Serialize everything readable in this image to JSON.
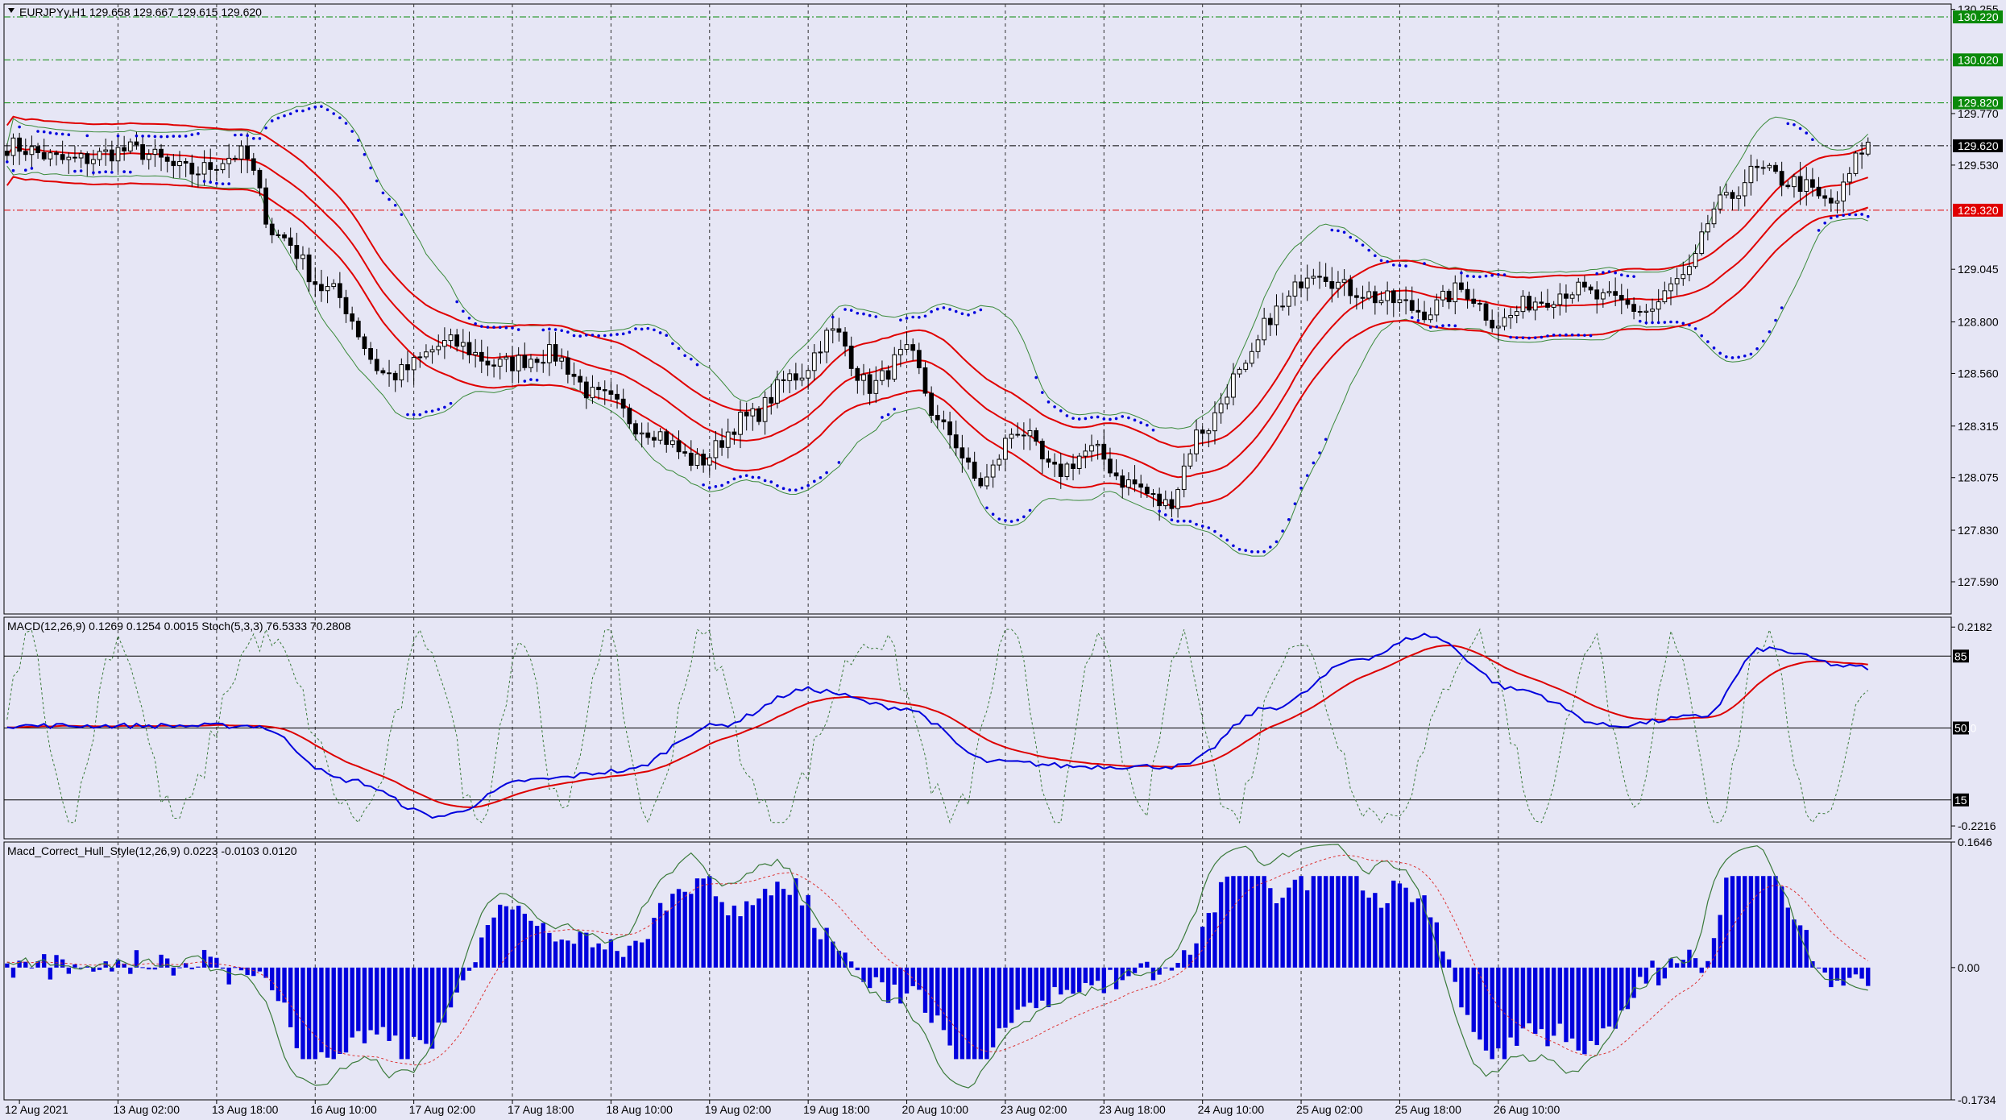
{
  "chart_data": [
    {
      "type": "candlestick",
      "title": "EURJPYy,H1",
      "header_values": "129.658 129.667 129.615 129.620",
      "indicators": [
        "Bollinger Bands",
        "Envelopes",
        "Parabolic SAR"
      ],
      "ylim": [
        127.44,
        130.28
      ],
      "y_ticks": [
        "130.255",
        "129.770",
        "129.530",
        "129.045",
        "128.800",
        "128.560",
        "128.315",
        "128.075",
        "127.830",
        "127.590"
      ],
      "levels": [
        {
          "value": 130.22,
          "label": "130.220",
          "color": "#0a8a0a",
          "style": "dashdot"
        },
        {
          "value": 130.02,
          "label": "130.020",
          "color": "#0a8a0a",
          "style": "dashdot"
        },
        {
          "value": 129.82,
          "label": "129.820",
          "color": "#0a8a0a",
          "style": "dashdot"
        },
        {
          "value": 129.62,
          "label": "129.620",
          "color": "#000000",
          "style": "dashdot"
        },
        {
          "value": 129.32,
          "label": "129.320",
          "color": "#e00000",
          "style": "dashdot"
        }
      ],
      "close_anchors": [
        [
          0,
          129.62
        ],
        [
          10,
          129.55
        ],
        [
          20,
          129.6
        ],
        [
          30,
          129.5
        ],
        [
          38,
          129.58
        ],
        [
          44,
          129.2
        ],
        [
          52,
          128.95
        ],
        [
          62,
          128.55
        ],
        [
          72,
          128.7
        ],
        [
          80,
          128.6
        ],
        [
          88,
          128.65
        ],
        [
          96,
          128.45
        ],
        [
          104,
          128.3
        ],
        [
          112,
          128.15
        ],
        [
          120,
          128.35
        ],
        [
          128,
          128.55
        ],
        [
          134,
          128.75
        ],
        [
          140,
          128.5
        ],
        [
          146,
          128.65
        ],
        [
          152,
          128.3
        ],
        [
          158,
          128.05
        ],
        [
          164,
          128.3
        ],
        [
          170,
          128.1
        ],
        [
          176,
          128.2
        ],
        [
          182,
          128.05
        ],
        [
          188,
          127.95
        ],
        [
          194,
          128.3
        ],
        [
          200,
          128.55
        ],
        [
          206,
          128.85
        ],
        [
          212,
          129.05
        ],
        [
          218,
          128.95
        ],
        [
          224,
          128.9
        ],
        [
          230,
          128.85
        ],
        [
          236,
          128.95
        ],
        [
          242,
          128.8
        ],
        [
          248,
          128.9
        ],
        [
          254,
          128.95
        ],
        [
          260,
          128.9
        ],
        [
          266,
          128.85
        ],
        [
          272,
          129.0
        ],
        [
          278,
          129.35
        ],
        [
          284,
          129.5
        ],
        [
          290,
          129.45
        ],
        [
          296,
          129.35
        ],
        [
          302,
          129.62
        ]
      ],
      "bars_total": 303,
      "bars_visible": 316,
      "up_color": "#ffffff",
      "down_color": "#000000"
    },
    {
      "type": "line",
      "title": "MACD(12,26,9) 0.1269 0.1254 0.0015  Stoch(5,3,3) 76.5333 70.2808",
      "ylim": [
        -0.25,
        0.24
      ],
      "y_ticks": [
        "0.2182",
        "-0.2216"
      ],
      "stoch_levels": [
        {
          "value": 85,
          "label": "85"
        },
        {
          "value": 50,
          "label": "50.0"
        },
        {
          "value": 15,
          "label": "15"
        }
      ],
      "macd_anchors": [
        [
          0,
          0.0
        ],
        [
          20,
          0.0
        ],
        [
          40,
          0.0
        ],
        [
          55,
          -0.12
        ],
        [
          70,
          -0.2
        ],
        [
          85,
          -0.12
        ],
        [
          100,
          -0.1
        ],
        [
          115,
          0.0
        ],
        [
          130,
          0.08
        ],
        [
          145,
          0.04
        ],
        [
          160,
          -0.08
        ],
        [
          175,
          -0.09
        ],
        [
          190,
          -0.09
        ],
        [
          205,
          0.04
        ],
        [
          220,
          0.15
        ],
        [
          230,
          0.2
        ],
        [
          245,
          0.08
        ],
        [
          260,
          0.0
        ],
        [
          275,
          0.02
        ],
        [
          285,
          0.17
        ],
        [
          300,
          0.13
        ],
        [
          302,
          0.127
        ]
      ],
      "series": [
        {
          "name": "MACD",
          "color": "#0000dd"
        },
        {
          "name": "Signal",
          "color": "#dd0000"
        },
        {
          "name": "Stoch",
          "color": "#3a7a3a"
        }
      ]
    },
    {
      "type": "bar",
      "title": "Macd_Correct_Hull_Style(12,26,9) 0.0223 -0.0103 0.0120",
      "ylim": [
        -0.1734,
        0.1646
      ],
      "y_ticks": [
        "0.1646",
        "0.00",
        "-0.1734"
      ],
      "hist_color": "#0000dd",
      "line_color": "#3a7a3a",
      "signal_color": "#dd3333"
    }
  ],
  "x_axis": {
    "labels": [
      "12 Aug 2021",
      "13 Aug 02:00",
      "13 Aug 18:00",
      "16 Aug 10:00",
      "17 Aug 02:00",
      "17 Aug 18:00",
      "18 Aug 10:00",
      "19 Aug 02:00",
      "19 Aug 18:00",
      "20 Aug 10:00",
      "23 Aug 02:00",
      "23 Aug 18:00",
      "24 Aug 10:00",
      "25 Aug 02:00",
      "25 Aug 18:00",
      "26 Aug 10:00"
    ],
    "bars_per_label": 16
  },
  "colors": {
    "background": "#e6e6f5",
    "grid": "#000000",
    "envelope": "#e00000",
    "bollinger": "#3a8a3a",
    "sar": "#0000dd"
  }
}
